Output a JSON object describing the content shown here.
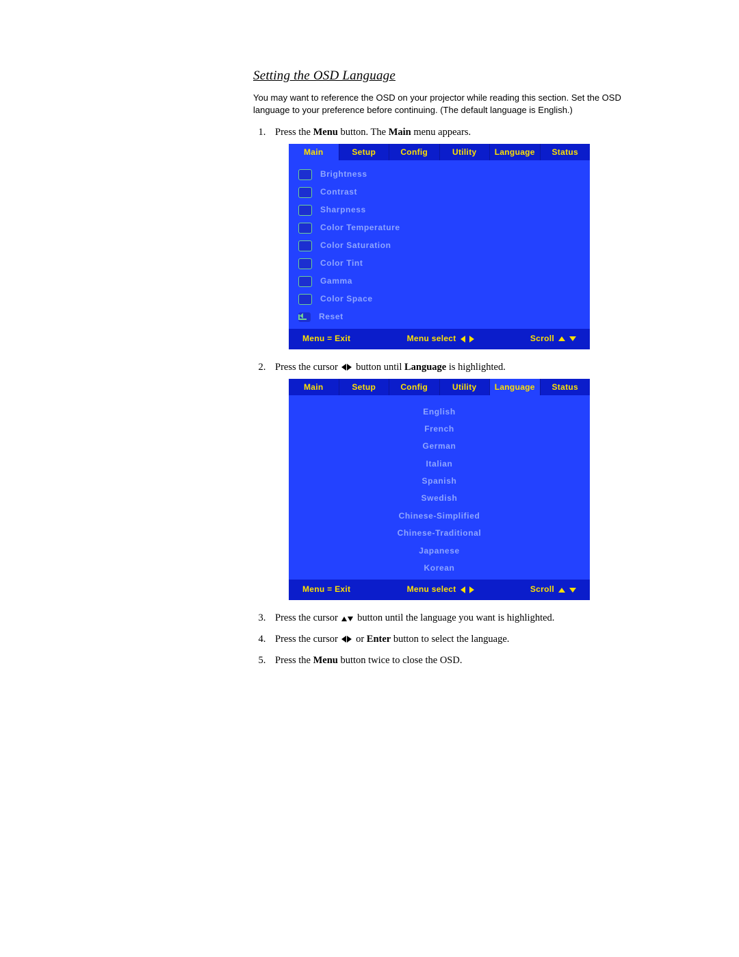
{
  "heading": "Setting the OSD Language",
  "intro": "You may want to reference the OSD on your projector while reading this section. Set the OSD language to your preference before continuing. (The default language is English.)",
  "steps": {
    "s1_a": "Press the ",
    "s1_b": "Menu",
    "s1_c": " button. The ",
    "s1_d": "Main",
    "s1_e": " menu appears.",
    "s2_a": "Press the cursor ",
    "s2_b": " button until ",
    "s2_c": "Language",
    "s2_d": " is highlighted.",
    "s3_a": "Press the cursor ",
    "s3_b": " button until the language you want is highlighted.",
    "s4_a": "Press the cursor ",
    "s4_b": " or ",
    "s4_c": "Enter",
    "s4_d": " button to select the language.",
    "s5_a": "Press the ",
    "s5_b": "Menu",
    "s5_c": " button twice to close the OSD."
  },
  "osd": {
    "tabs": [
      "Main",
      "Setup",
      "Config",
      "Utility",
      "Language",
      "Status"
    ],
    "main_items": [
      "Brightness",
      "Contrast",
      "Sharpness",
      "Color Temperature",
      "Color Saturation",
      "Color Tint",
      "Gamma",
      "Color Space",
      "Reset"
    ],
    "languages": [
      "English",
      "French",
      "German",
      "Italian",
      "Spanish",
      "Swedish",
      "Chinese-Simplified",
      "Chinese-Traditional",
      "Japanese",
      "Korean"
    ],
    "footer": {
      "exit": "Menu = Exit",
      "select": "Menu select",
      "scroll": "Scroll"
    }
  }
}
